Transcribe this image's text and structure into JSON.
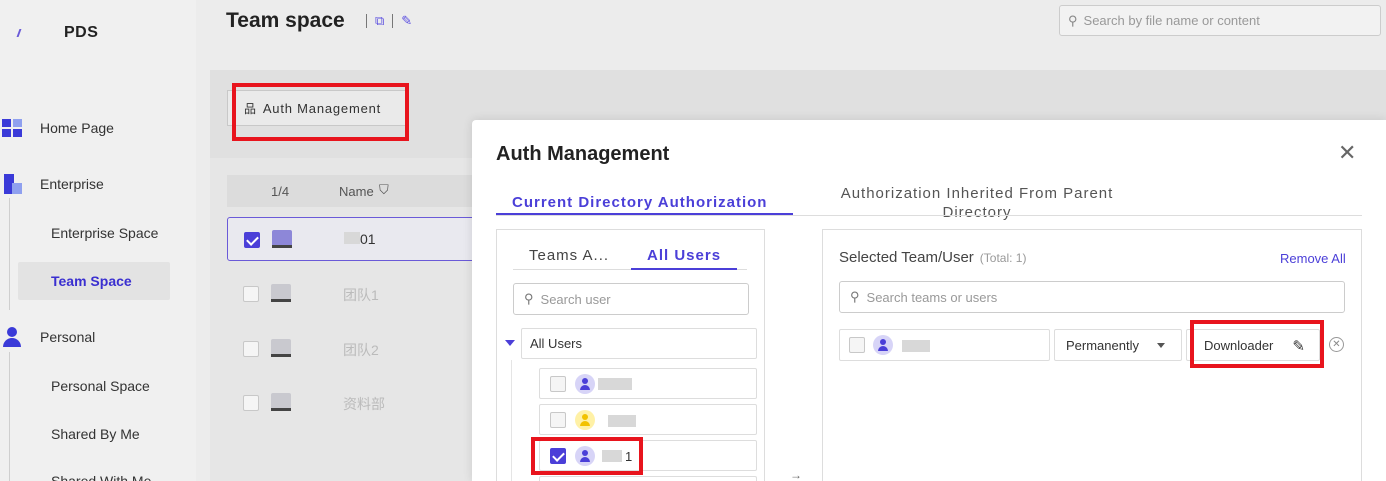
{
  "app": {
    "name": "PDS"
  },
  "sidebar": {
    "items": [
      {
        "label": "Home Page"
      },
      {
        "label": "Enterprise"
      },
      {
        "label": "Enterprise Space"
      },
      {
        "label": "Team Space"
      },
      {
        "label": "Personal"
      },
      {
        "label": "Personal Space"
      },
      {
        "label": "Shared By Me"
      },
      {
        "label": "Shared With Me"
      }
    ]
  },
  "header": {
    "title": "Team space",
    "search_placeholder": "Search by file name or content"
  },
  "toolbar": {
    "auth_label": "Auth Management"
  },
  "table": {
    "page": "1/4",
    "name_header": "Name",
    "rows": [
      {
        "name": "01",
        "selected": true
      },
      {
        "name": "团队1",
        "selected": false
      },
      {
        "name": "团队2",
        "selected": false
      },
      {
        "name": "资料部",
        "selected": false
      }
    ]
  },
  "modal": {
    "title": "Auth Management",
    "tabs": [
      {
        "label": "Current Directory Authorization"
      },
      {
        "label": "Authorization Inherited From Parent Directory"
      }
    ],
    "left": {
      "subtabs": [
        {
          "label": "Teams A..."
        },
        {
          "label": "All Users"
        }
      ],
      "search_placeholder": "Search user",
      "root_label": "All Users",
      "users": [
        {
          "label": "",
          "checked": false
        },
        {
          "label": "",
          "checked": false
        },
        {
          "label": "1",
          "checked": true
        }
      ]
    },
    "right": {
      "title": "Selected Team/User",
      "total": "(Total: 1)",
      "remove_all": "Remove All",
      "search_placeholder": "Search teams or users",
      "duration": "Permanently",
      "role": "Downloader"
    }
  },
  "colors": {
    "accent": "#4b3fd8",
    "highlight": "#e8141d"
  }
}
